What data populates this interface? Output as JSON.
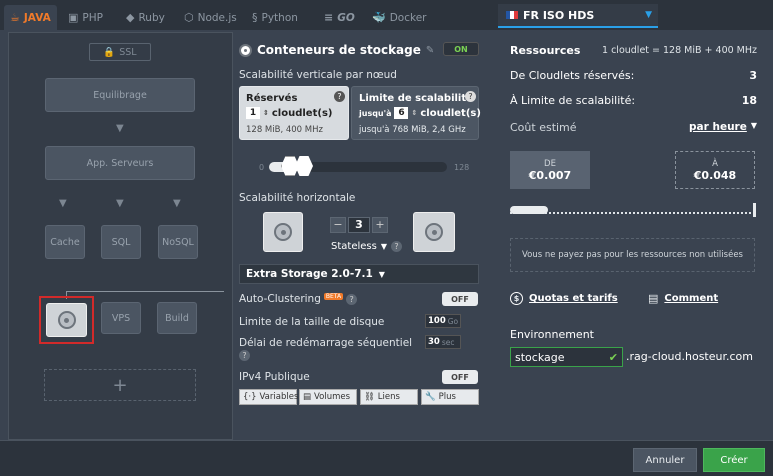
{
  "tabs": [
    {
      "label": "JAVA",
      "icon": "java-icon"
    },
    {
      "label": "PHP",
      "icon": "php-icon"
    },
    {
      "label": "Ruby",
      "icon": "ruby-icon"
    },
    {
      "label": "Node.js",
      "icon": "nodejs-icon"
    },
    {
      "label": "Python",
      "icon": "python-icon"
    },
    {
      "label": "GO",
      "icon": "go-icon"
    },
    {
      "label": "Docker",
      "icon": "docker-icon"
    }
  ],
  "topology": {
    "ssl": "SSL",
    "balancing": "Equilibrage",
    "app_servers": "App. Serveurs",
    "cache": "Cache",
    "sql": "SQL",
    "nosql": "NoSQL",
    "vps": "VPS",
    "build": "Build",
    "add": "+"
  },
  "storage": {
    "title": "Conteneurs de stockage",
    "toggle": "ON",
    "vertical_label": "Scalabilité verticale par nœud",
    "reserved": {
      "title": "Réservés",
      "value": "1",
      "unit": "cloudlet(s)",
      "info": "128 MiB, 400 MHz"
    },
    "limit": {
      "title": "Limite de scalabilité",
      "prefix": "jusqu'à",
      "value": "6",
      "unit": "cloudlet(s)",
      "info": "jusqu'à 768 MiB, 2,4 GHz"
    },
    "slider_min": "0",
    "slider_max": "128",
    "horizontal_label": "Scalabilité horizontale",
    "minus": "−",
    "count": "3",
    "plus": "+",
    "stateless": "Stateless",
    "version": "Extra Storage 2.0-7.1",
    "auto_clustering": "Auto-Clustering",
    "beta": "BETA",
    "auto_toggle": "OFF",
    "disk_limit_label": "Limite de la taille de disque",
    "disk_value": "100",
    "disk_unit": "Go",
    "restart_label": "Délai de redémarrage séquentiel",
    "restart_value": "30",
    "restart_unit": "sec",
    "ipv4_label": "IPv4 Publique",
    "ipv4_toggle": "OFF",
    "buttons": [
      "Variables",
      "Volumes",
      "Liens",
      "Plus"
    ]
  },
  "right": {
    "region": "FR ISO HDS",
    "resources_title": "Ressources",
    "cloudlet_info": "1 cloudlet = 128 MiB + 400 MHz",
    "reserved_label": "De Cloudlets réservés:",
    "reserved_value": "3",
    "limit_label": "À Limite de scalabilité:",
    "limit_value": "18",
    "cost_label": "Coût estimé",
    "cost_period": "par heure",
    "from_label": "DE",
    "from_value": "€0.007",
    "to_label": "À",
    "to_value": "€0.048",
    "unused_note": "Vous ne payez pas pour les ressources non utilisées",
    "quotas_link": "Quotas et tarifs",
    "comment_link": "Comment",
    "env_label": "Environnement",
    "env_value": "stockage",
    "env_domain": ".rag-cloud.hosteur.com"
  },
  "footer": {
    "cancel": "Annuler",
    "create": "Créer"
  },
  "colors": {
    "accent": "#f07a2a",
    "success": "#3aa34a",
    "selection": "#d22a2a",
    "link": "#2aa0e8"
  }
}
